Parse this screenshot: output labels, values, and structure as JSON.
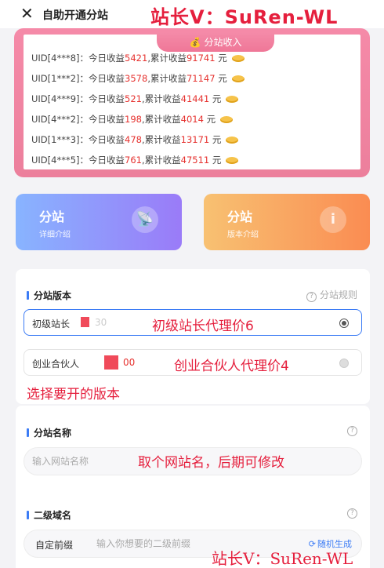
{
  "header": {
    "title": "自助开通分站",
    "close_icon": "close-icon",
    "watermark": "站长V：SuRen-WL"
  },
  "income": {
    "tab_label": "分站收入",
    "rows": [
      {
        "uid": "UID[4***8]：",
        "today_label": "今日收益",
        "today": "5421",
        "total_label": ",累计收益",
        "total": "91741",
        "unit": "元"
      },
      {
        "uid": "UID[1***2]：",
        "today_label": "今日收益",
        "today": "3578",
        "total_label": ",累计收益",
        "total": "71147",
        "unit": "元"
      },
      {
        "uid": "UID[4***9]：",
        "today_label": "今日收益",
        "today": "521",
        "total_label": ",累计收益",
        "total": "41441",
        "unit": "元"
      },
      {
        "uid": "UID[4***2]：",
        "today_label": "今日收益",
        "today": "198",
        "total_label": ",累计收益",
        "total": "4014",
        "unit": "元"
      },
      {
        "uid": "UID[1***3]：",
        "today_label": "今日收益",
        "today": "478",
        "total_label": ",累计收益",
        "total": "13171",
        "unit": "元"
      },
      {
        "uid": "UID[4***5]：",
        "today_label": "今日收益",
        "today": "761",
        "total_label": ",累计收益",
        "total": "47511",
        "unit": "元"
      }
    ]
  },
  "promos": [
    {
      "title": "分站",
      "subtitle": "详细介绍",
      "icon": "satellite-icon"
    },
    {
      "title": "分站",
      "subtitle": "版本介绍",
      "icon": "info-icon"
    }
  ],
  "version": {
    "section_title": "分站版本",
    "rules_link": "分站规则",
    "options": [
      {
        "name": "初级站长",
        "price": "30",
        "selected": true,
        "overlay": "初级站长代理价6"
      },
      {
        "name": "创业合伙人",
        "price": "00",
        "selected": false,
        "overlay": "创业合伙人代理价4"
      }
    ],
    "hint_overlay": "选择要开的版本"
  },
  "site_name": {
    "section_title": "分站名称",
    "placeholder": "输入网站名称",
    "overlay": "取个网站名，后期可修改"
  },
  "subdomain": {
    "section_title": "二级域名",
    "prefix_label": "自定前缀",
    "placeholder": "输入你想要的二级前缀",
    "random_button": "随机生成"
  },
  "footer_watermark": "站长V：SuRen-WL",
  "colors": {
    "accent": "#3c7cf5",
    "income_red": "#e6322f",
    "watermark": "#e51f3d",
    "card_pink": "#f08aa6"
  }
}
